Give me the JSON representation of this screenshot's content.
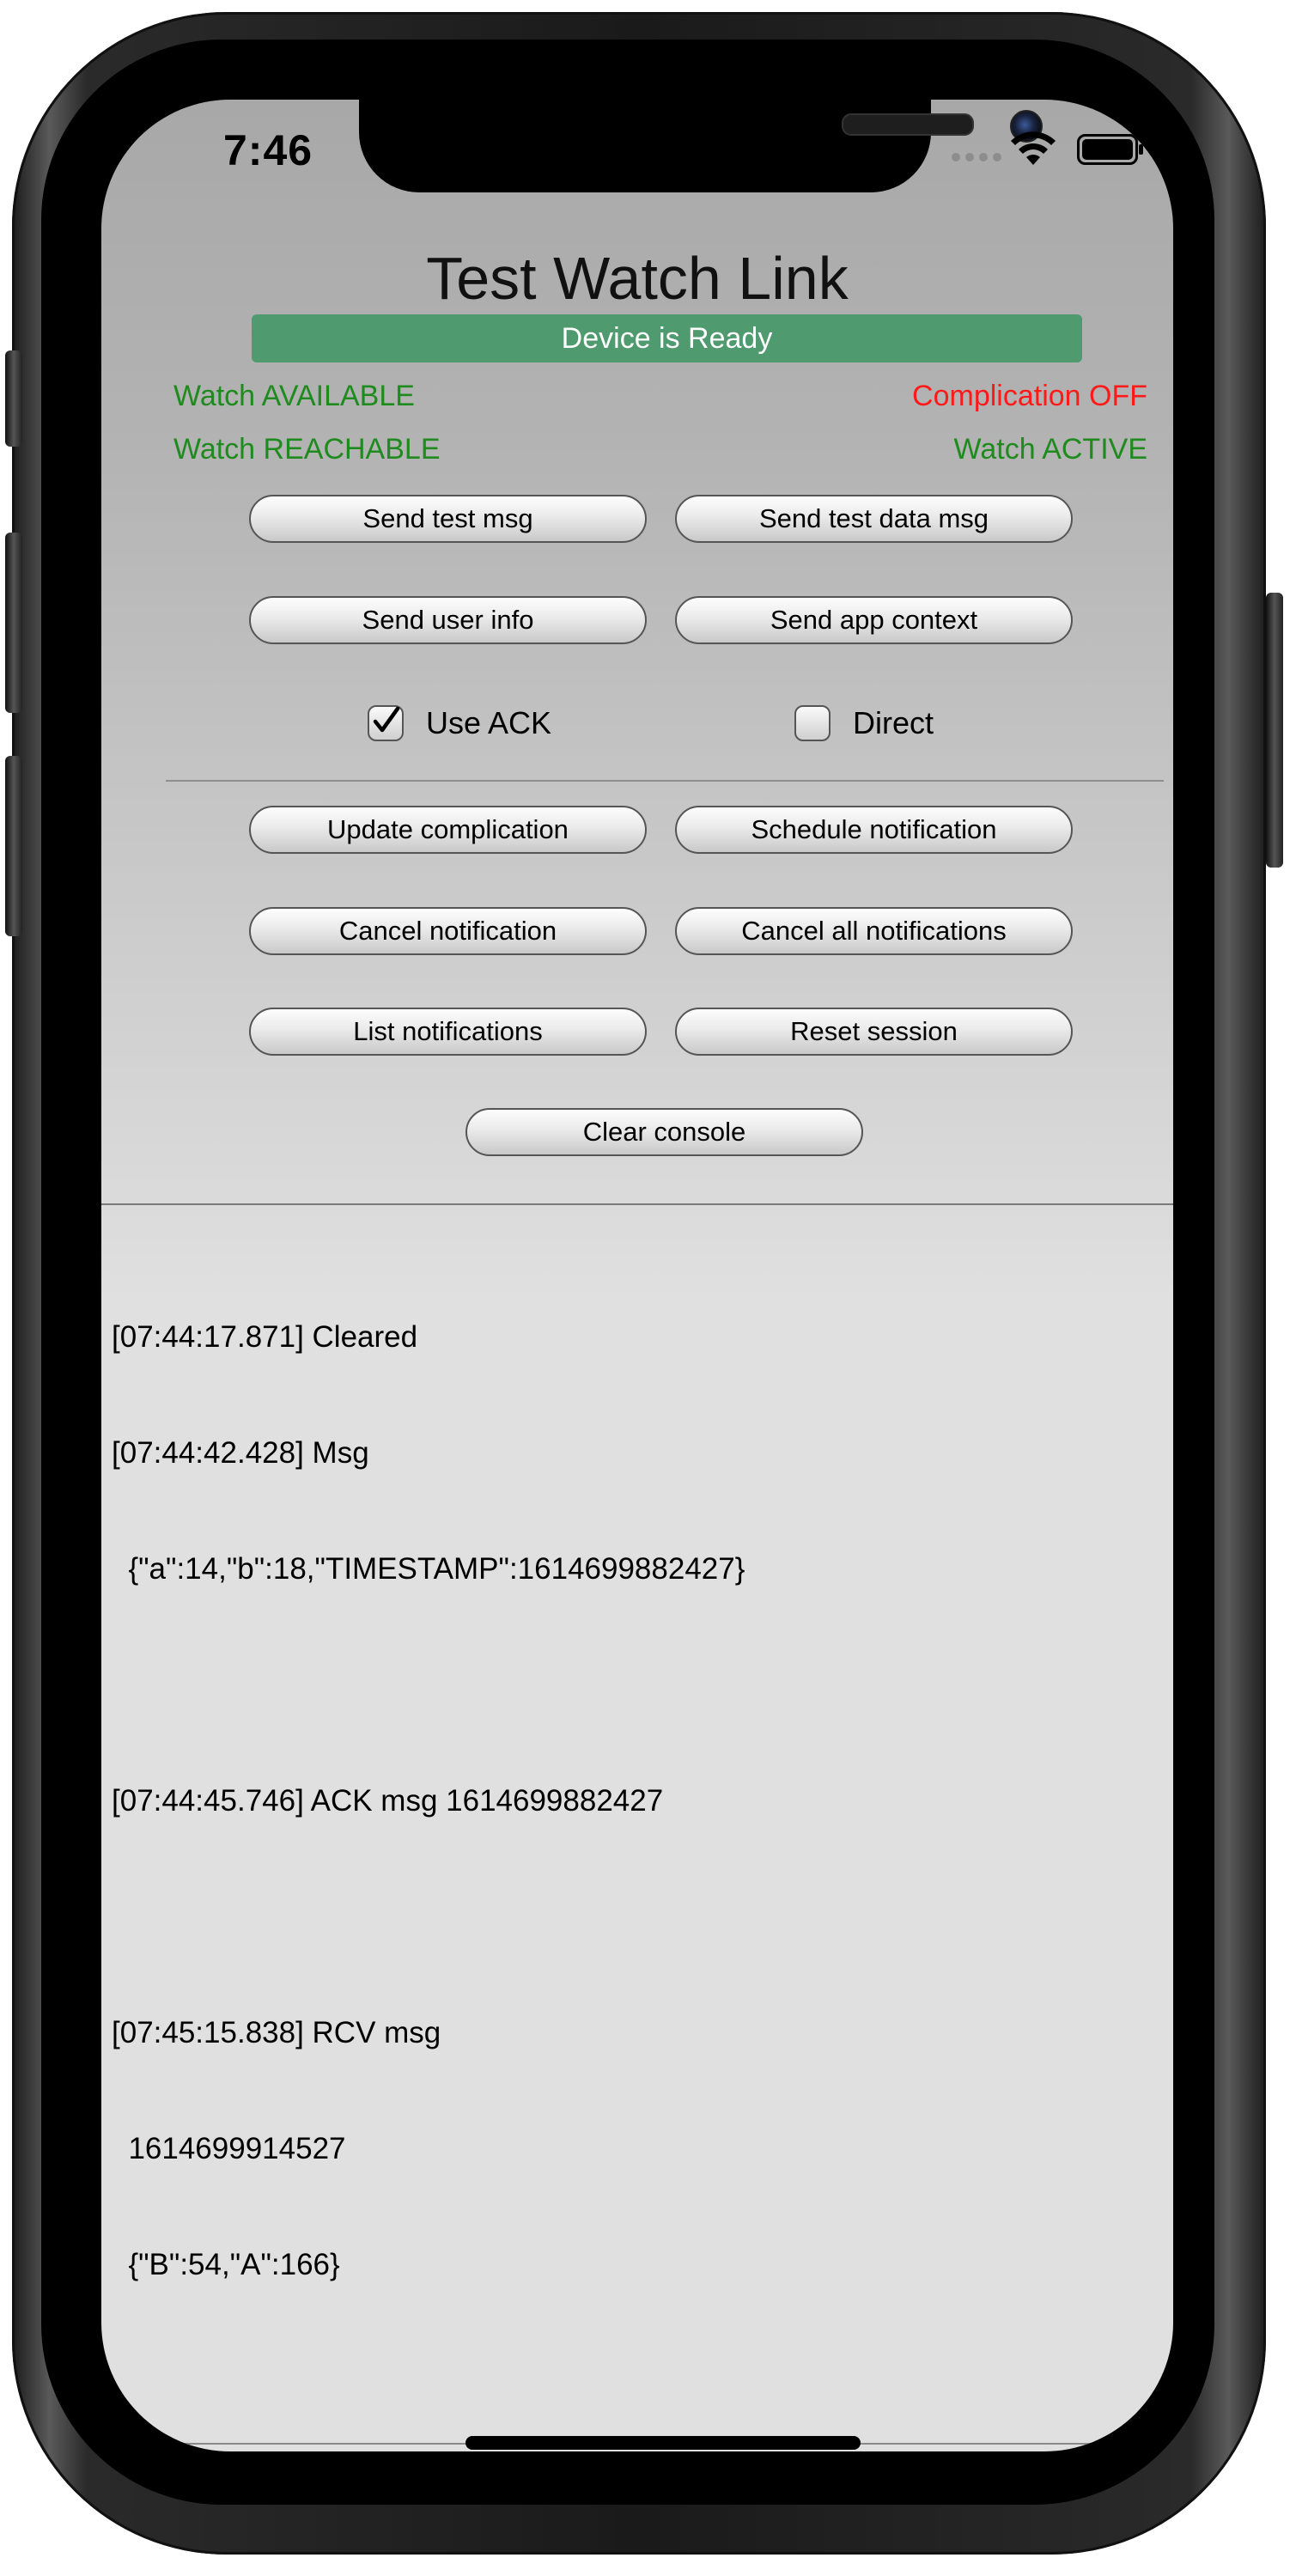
{
  "status_bar": {
    "time": "7:46",
    "icons": [
      "signal-dots-icon",
      "wifi-icon",
      "battery-icon"
    ]
  },
  "app": {
    "title": "Test Watch Link",
    "ready_banner": "Device is Ready",
    "colors": {
      "banner": "#4f9a6e",
      "status_ok": "#1f8b1f",
      "status_off": "#ff1a1a"
    }
  },
  "status": {
    "available": "Watch AVAILABLE",
    "complication": "Complication OFF",
    "reachable": "Watch REACHABLE",
    "active": "Watch ACTIVE"
  },
  "buttons": {
    "send_test_msg": "Send test msg",
    "send_test_data_msg": "Send test data msg",
    "send_user_info": "Send user info",
    "send_app_context": "Send app context",
    "update_complication": "Update complication",
    "schedule_notification": "Schedule notification",
    "cancel_notification": "Cancel notification",
    "cancel_all_notifications": "Cancel all notifications",
    "list_notifications": "List notifications",
    "reset_session": "Reset session",
    "clear_console": "Clear console"
  },
  "options": {
    "use_ack": {
      "label": "Use ACK",
      "checked": true
    },
    "direct": {
      "label": "Direct",
      "checked": false
    }
  },
  "console": {
    "lines": [
      "[07:44:17.871] Cleared",
      "[07:44:42.428] Msg",
      "  {\"a\":14,\"b\":18,\"TIMESTAMP\":1614699882427}",
      "",
      "[07:44:45.746] ACK msg 1614699882427",
      "",
      "[07:45:15.838] RCV msg",
      "  1614699914527",
      "  {\"B\":54,\"A\":166}"
    ]
  }
}
